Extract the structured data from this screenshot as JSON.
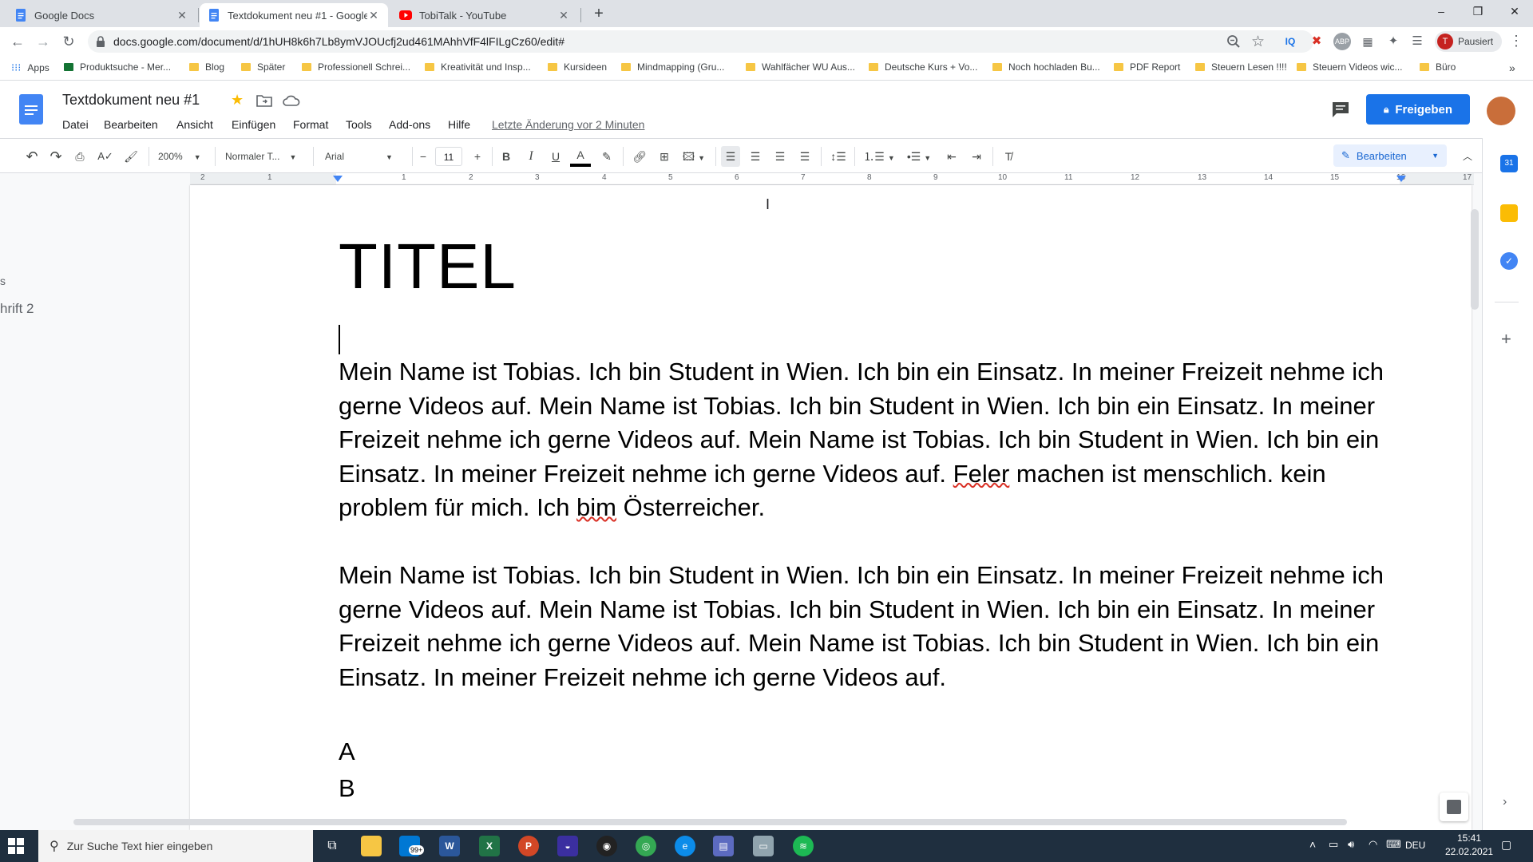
{
  "browser": {
    "tabs": [
      {
        "title": "Google Docs",
        "icon": "docs-icon",
        "active": false
      },
      {
        "title": "Textdokument neu #1 - Google Docs",
        "icon": "docs-icon",
        "active": true
      },
      {
        "title": "TobiTalk - YouTube",
        "icon": "youtube-icon",
        "active": false
      }
    ],
    "url": "docs.google.com/document/d/1hUH8k6h7Lb8ymVJOUcfj2ud461MAhhVfF4lFILgCz60/edit#",
    "profile_label": "Pausiert",
    "profile_initial": "T",
    "bookmarks": [
      "Apps",
      "Produktsuche - Mer...",
      "Blog",
      "Später",
      "Professionell Schrei...",
      "Kreativität und Insp...",
      "Kursideen",
      "Mindmapping (Gru...",
      "Wahlfächer WU Aus...",
      "Deutsche Kurs + Vo...",
      "Noch hochladen Bu...",
      "PDF Report",
      "Steuern Lesen !!!!",
      "Steuern Videos wic...",
      "Büro"
    ],
    "bookmarks_more": "»"
  },
  "docs": {
    "title": "Textdokument neu #1",
    "menus": [
      "Datei",
      "Bearbeiten",
      "Ansicht",
      "Einfügen",
      "Format",
      "Tools",
      "Add-ons",
      "Hilfe"
    ],
    "last_edit": "Letzte Änderung vor 2 Minuten",
    "share_label": "Freigeben",
    "toolbar": {
      "zoom": "200%",
      "style": "Normaler T...",
      "font": "Arial",
      "font_size": "11",
      "minus": "−",
      "plus": "+",
      "bold": "B",
      "italic": "I",
      "underline": "U",
      "text_color": "A",
      "edit_mode": "Bearbeiten"
    },
    "ruler": [
      "2",
      "1",
      "1",
      "2",
      "3",
      "4",
      "5",
      "6",
      "7",
      "8",
      "9",
      "10",
      "11",
      "12",
      "13",
      "14",
      "15",
      "16",
      "17"
    ],
    "outline": {
      "item1": "s",
      "item2": "hrift 2"
    },
    "content": {
      "heading": "TITEL",
      "para1": {
        "a": "Mein Name ist Tobias. Ich bin Student in Wien. Ich bin ein Einsatz. In meiner Freizeit nehme ich gerne Videos auf. Mein Name ist Tobias. Ich bin Student in Wien. Ich bin ein Einsatz. In meiner Freizeit nehme ich gerne Videos auf. Mein Name ist Tobias. Ich bin Student in Wien. Ich bin ein Einsatz. In meiner Freizeit nehme ich gerne Videos auf. ",
        "err1": "Feler",
        "b": " machen ist menschlich. kein problem für mich. Ich ",
        "err2": "bim",
        "c": " Österreicher."
      },
      "para2": "Mein Name ist Tobias. Ich bin Student in Wien. Ich bin ein Einsatz. In meiner Freizeit nehme ich gerne Videos auf. Mein Name ist Tobias. Ich bin Student in Wien. Ich bin ein Einsatz. In meiner Freizeit nehme ich gerne Videos auf. Mein Name ist Tobias. Ich bin Student in Wien. Ich bin ein Einsatz. In meiner Freizeit nehme ich gerne Videos auf.",
      "line_a": "A",
      "line_b": "B"
    }
  },
  "taskbar": {
    "search_placeholder": "Zur Suche Text hier eingeben",
    "mail_badge": "99+",
    "language": "DEU",
    "time": "15:41",
    "date": "22.02.2021"
  },
  "colors": {
    "accent": "#1a73e8",
    "spell_error": "#d93025",
    "taskbar": "#1f2f3f"
  }
}
